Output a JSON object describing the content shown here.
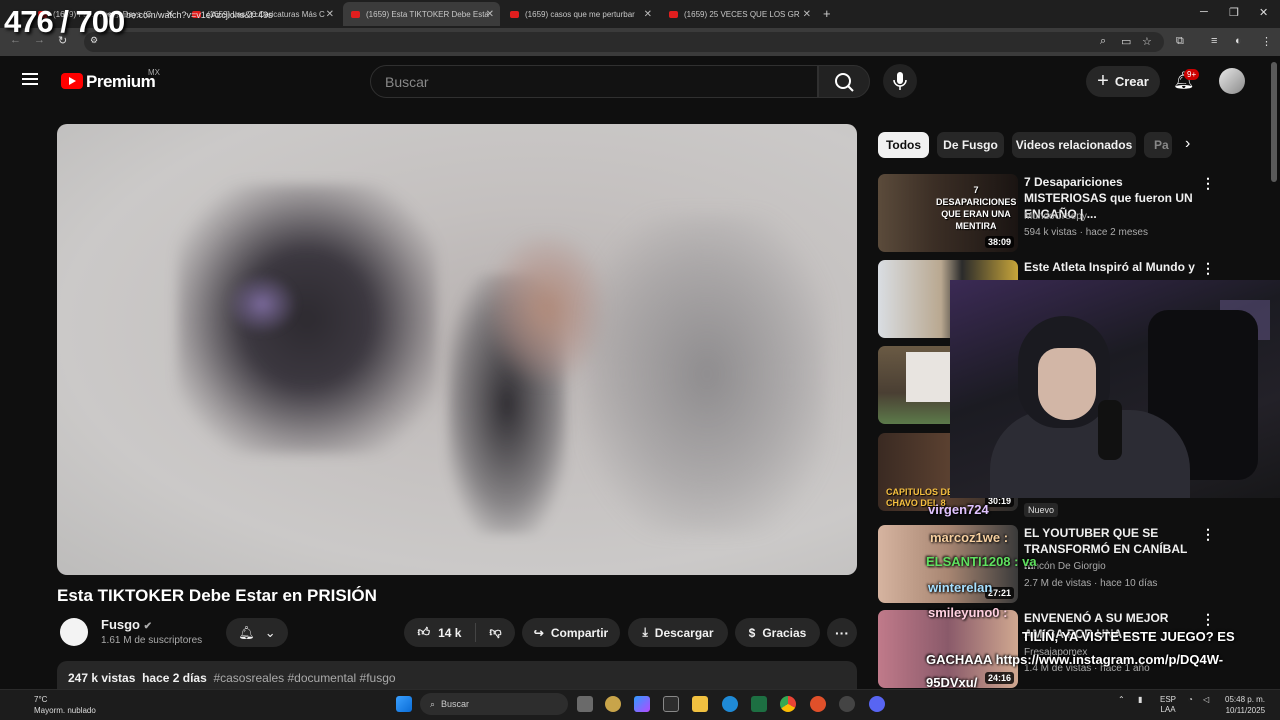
{
  "overlay": {
    "counter": "476 / 700"
  },
  "browser": {
    "tabs": [
      {
        "title": "(1659) Fal... These Days (C"
      },
      {
        "title": "(1659) Las 20 Caricaturas Más C"
      },
      {
        "title": "(1659) Esta TIKTOKER Debe Esta",
        "active": true
      },
      {
        "title": "(1659) casos que me perturbar"
      },
      {
        "title": "(1659) 25 VECES QUE LOS GR"
      }
    ],
    "url": "youtube.com/watch?v=v1eAzcjiohs&t=49s"
  },
  "header": {
    "logo_text": "Premium",
    "region": "MX",
    "search_placeholder": "Buscar",
    "create_label": "Crear",
    "notifications": "9+"
  },
  "video": {
    "title": "Esta TIKTOKER Debe Estar en PRISIÓN",
    "channel": "Fusgo",
    "subscribers": "1.61 M de suscriptores",
    "likes": "14 k",
    "share_label": "Compartir",
    "download_label": "Descargar",
    "thanks_label": "Gracias",
    "views": "247 k vistas",
    "date": "hace 2 días",
    "hashtags": "#casosreales #documental #fusgo"
  },
  "chips": [
    "Todos",
    "De Fusgo",
    "Videos relacionados",
    "Pa"
  ],
  "related": [
    {
      "title": "7 Desapariciones MISTERIOSAS que fueron UN ENGAÑO | ...",
      "channel": "MundoCreepy",
      "meta": "594 k vistas · hace 2 meses",
      "duration": "38:09",
      "thumb_caption": "7 DESAPARICIONES QUE ERAN UNA MENTIRA"
    },
    {
      "title": "Este Atleta Inspiró al Mundo y",
      "channel": "",
      "meta": "",
      "duration": ""
    },
    {
      "title": "",
      "channel": "",
      "meta": "",
      "duration": ""
    },
    {
      "title": "",
      "channel": "",
      "meta": "",
      "duration": "30:19",
      "thumb_caption": "CAPITULOS DEL CHAVO DEL 8"
    },
    {
      "title": "EL YOUTUBER QUE SE TRANSFORMÓ EN CANÍBAL ...",
      "channel": "Rincón De Giorgio",
      "meta": "2.7 M de vistas · hace 10 días",
      "duration": "27:21",
      "badge": "Nuevo"
    },
    {
      "title": "ENVENENÓ A SU MEJOR AMIGA POR UNA ...",
      "channel": "Fresajapomex",
      "meta": "1.4 M de vistas · hace 1 año",
      "duration": "24:16"
    }
  ],
  "stream_chat": [
    {
      "text": "virgen724"
    },
    {
      "text": "marcoz1we :"
    },
    {
      "text": "ELSANTI1208 : va"
    },
    {
      "text": "winterelan"
    },
    {
      "text": "smileyuno0 :"
    },
    {
      "text": "TILÍN, YA VISTE ESTE JUEGO? ES"
    },
    {
      "text": "GACHAAA https://www.instagram.com/p/DQ4W-"
    },
    {
      "text": "95DVxu/"
    }
  ],
  "taskbar": {
    "weather_temp": "7°C",
    "weather_desc": "Mayorm. nublado",
    "search_label": "Buscar",
    "lang": "ESP",
    "lang_sub": "LAA",
    "time": "05:48 p. m.",
    "date": "10/11/2025"
  },
  "colors": {
    "accent": "#ff0000",
    "background": "#0f0f0f",
    "chip_active": "#f1f1f1"
  }
}
